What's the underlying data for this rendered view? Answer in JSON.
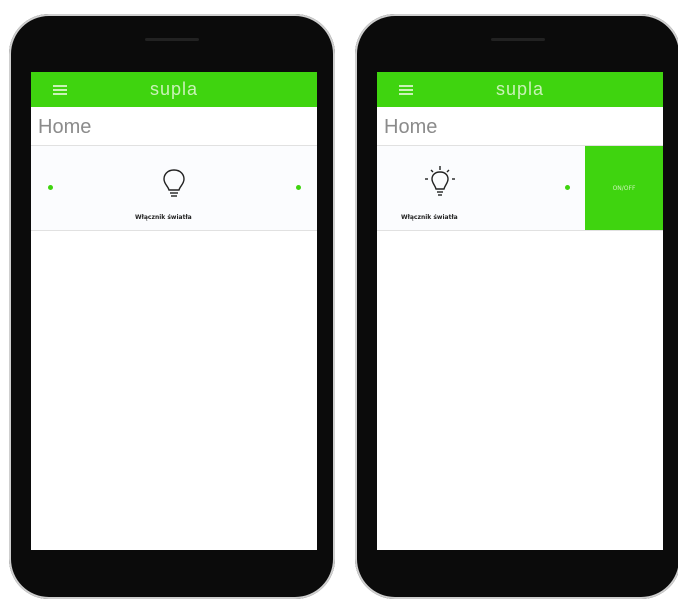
{
  "app": {
    "title": "supla"
  },
  "page": {
    "title": "Home"
  },
  "device": {
    "label": "Włącznik światła"
  },
  "swipe_action": {
    "label": "ON/OFF"
  },
  "colors": {
    "accent": "#3fd40f",
    "title_text": "#c9f2b7"
  }
}
